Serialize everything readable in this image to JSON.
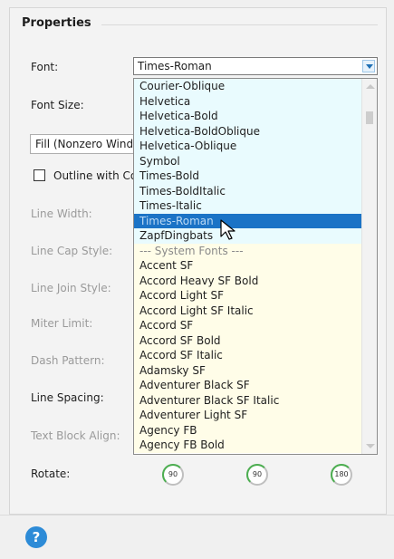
{
  "panel": {
    "title": "Properties",
    "font_label": "Font:",
    "font_value": "Times-Roman",
    "font_size_label": "Font Size:",
    "fill_value": "Fill (Nonzero Winding)",
    "outline_label": "Outline with Co",
    "line_width_label": "Line Width:",
    "line_cap_label": "Line Cap Style:",
    "line_join_label": "Line Join Style:",
    "miter_label": "Miter Limit:",
    "dash_label": "Dash Pattern:",
    "line_spacing_label": "Line Spacing:",
    "text_block_label": "Text Block Align:",
    "rotate_label": "Rotate:",
    "rotate_buttons": [
      "90",
      "90",
      "180"
    ]
  },
  "font_list": {
    "pdf_fonts": [
      "Courier-Oblique",
      "Helvetica",
      "Helvetica-Bold",
      "Helvetica-BoldOblique",
      "Helvetica-Oblique",
      "Symbol",
      "Times-Bold",
      "Times-BoldItalic",
      "Times-Italic",
      "Times-Roman",
      "ZapfDingbats"
    ],
    "separator": "--- System Fonts ---",
    "system_fonts": [
      "Accent SF",
      "Accord Heavy SF Bold",
      "Accord Light SF",
      "Accord Light SF Italic",
      "Accord SF",
      "Accord SF Bold",
      "Accord SF Italic",
      "Adamsky SF",
      "Adventurer Black SF",
      "Adventurer Black SF Italic",
      "Adventurer Light SF",
      "Agency FB",
      "Agency FB Bold"
    ],
    "selected": "Times-Roman"
  },
  "footer": {
    "help_glyph": "?"
  },
  "icons": {
    "dropdown_arrow": "chevron-down-icon",
    "help": "help-icon",
    "rotate": "rotate-icon",
    "cursor": "mouse-pointer-icon"
  },
  "colors": {
    "accent": "#1b73c6",
    "pdf_font_bg": "#e9fbfe",
    "system_font_bg": "#fffde8",
    "help_blue": "#2d8bd7",
    "rotate_green": "#4caf50"
  }
}
